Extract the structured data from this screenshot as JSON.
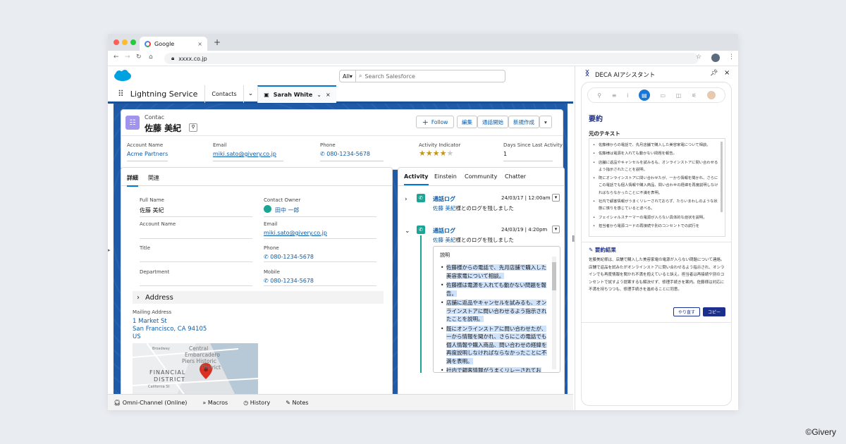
{
  "browser": {
    "tab_title": "Google",
    "new_tab": "+",
    "url": "xxxx.co.jp",
    "close_tab": "×"
  },
  "sf": {
    "search_scope": "All",
    "search_placeholder": "Search Salesforce",
    "app_name": "Lightning Service",
    "nav_contacts": "Contacts",
    "record_tab": "Sarah White"
  },
  "record": {
    "object_label": "Contac",
    "name": "佐藤 美紀",
    "follow": "Follow",
    "actions": [
      "編集",
      "通話開始",
      "新規作成"
    ],
    "highlights": {
      "account_label": "Account Name",
      "account_value": "Acme Partners",
      "email_label": "Email",
      "email_value": "miki.sato@givery.co.jp",
      "phone_label": "Phone",
      "phone_value": "080-1234-5678",
      "activity_label": "Activity Indicator",
      "activity_rating": 4,
      "activity_stars_max": 5,
      "days_label": "Days Since Last Activity",
      "days_value": "1"
    }
  },
  "detail": {
    "tab_details": "詳細",
    "tab_related": "関連",
    "fullname_label": "Full Name",
    "fullname_value": "佐藤 美紀",
    "owner_label": "Contact Owner",
    "owner_value": "田中 一郎",
    "account_label": "Account Name",
    "email_label": "Email",
    "email_value": "miki.sato@givery.co.jp",
    "title_label": "Title",
    "phone_label": "Phone",
    "phone_value": "080-1234-5678",
    "dept_label": "Department",
    "mobile_label": "Mobile",
    "mobile_value": "080-1234-5678",
    "address_section": "Address",
    "mailing_label": "Mailing Address",
    "mailing_line1": "1 Market St",
    "mailing_line2": "San Francisco, CA 94105",
    "mailing_line3": "US",
    "map_labels": {
      "broadway": "Broadway",
      "central": "Central",
      "embarcadero": "Embarcadero",
      "piers": "Piers Historic",
      "district": "District",
      "financial": "FINANCIAL",
      "financial2": "DISTRICT",
      "california": "California St"
    }
  },
  "activity": {
    "tabs": [
      "Activity",
      "Einstein",
      "Community",
      "Chatter"
    ],
    "item1": {
      "title": "通話ログ",
      "date": "24/03/17 | 12:00am",
      "who": "佐藤 美紀",
      "desc": "様とのログを残しました"
    },
    "item2": {
      "title": "通話ログ",
      "date": "24/03/19 | 4:20pm",
      "who": "佐藤 美紀",
      "desc": "様とのログを残しました"
    },
    "desc_label": "説明",
    "bullets": [
      "佐藤様からの電話で、先月店舗で購入した美容家電について相談。",
      "佐藤様は電源を入れても動かない問題を報告。",
      "店舗に返品やキャンセルを試みるも、オンラインストアに問い合わせるよう指示されたことを説明。",
      "既にオンラインストアに問い合わせたが、一から情報を聞かれ、さらにこの電話でも個人情報や購入商品、問い合わせの経緯を再度説明しなければならなかったことに不満を表明。",
      "社内で顧客情報がうまくリレーされてお"
    ]
  },
  "utility": [
    "Omni-Channel (Online)",
    "Macros",
    "History",
    "Notes"
  ],
  "deca": {
    "title": "DECA AIアシスタント",
    "section_title": "要約",
    "source_label": "元のテキスト",
    "source_bullets": [
      "佐藤様からの電話で、先月店舗で購入した美容家電について相談。",
      "佐藤様は電源を入れても動かない問題を報告。",
      "店舗に返品やキャンセルを試みるも、オンラインストアに問い合わせるよう指示されたことを説明。",
      "既にオンラインストアに問い合わせたが、一から情報を聞かれ、さらにこの電話でも個人情報や購入商品、問い合わせの経緯を再度説明しなければならなかったことに不満を表明。",
      "社内で顧客情報がうまくリレーされておらず、たらいまわしのような状態に憤りを感じていると述べる。",
      "フェイシャルスチーマーの電源が入らない具体的な症状を説明。",
      "担当者から電源コードの再接続や別のコンセントでの試行を"
    ],
    "result_label": "要約結果",
    "result_text": "佐藤美紀様は、店舗で購入した美容家電の電源が入らない問題について連絡。店舗で返品を試みたがオンラインストアに問い合わせるよう指示され、オンラインでも再度情報を聞かれ不満を抱えていると訴え。担当者は再接続や別のコンセントで試すよう提案するも解決せず、修理手続きを案内。佐藤様は対応に不満を持ちつつも、修理手続きを進めることに同意。",
    "redo": "やり直す",
    "copy": "コピー"
  },
  "copyright": "©Givery",
  "colors": {
    "brand": "#0176d3",
    "stage": "#1e5aa8",
    "activity_icon": "#1aa594",
    "deca_accent": "#1b2f8f"
  }
}
